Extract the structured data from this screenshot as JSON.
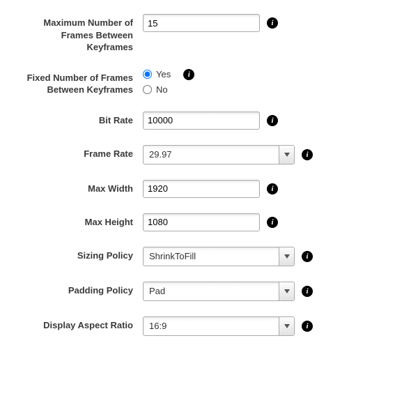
{
  "fields": {
    "maxFramesBetweenKeyframes": {
      "label": "Maximum Number of Frames Between Keyframes",
      "value": "15"
    },
    "fixedNumberFrames": {
      "label": "Fixed Number of Frames Between Keyframes",
      "option_yes": "Yes",
      "option_no": "No",
      "selected": "yes"
    },
    "bitRate": {
      "label": "Bit Rate",
      "value": "10000"
    },
    "frameRate": {
      "label": "Frame Rate",
      "value": "29.97"
    },
    "maxWidth": {
      "label": "Max Width",
      "value": "1920"
    },
    "maxHeight": {
      "label": "Max Height",
      "value": "1080"
    },
    "sizingPolicy": {
      "label": "Sizing Policy",
      "value": "ShrinkToFill"
    },
    "paddingPolicy": {
      "label": "Padding Policy",
      "value": "Pad"
    },
    "displayAspectRatio": {
      "label": "Display Aspect Ratio",
      "value": "16:9"
    }
  }
}
